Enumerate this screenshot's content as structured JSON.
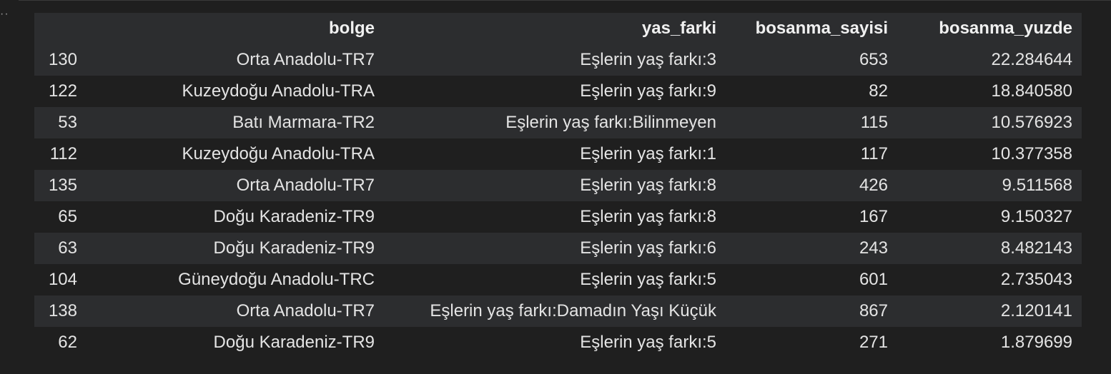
{
  "output": {
    "prompt_marker": "··"
  },
  "dataframe": {
    "index_header": "",
    "columns": [
      "bolge",
      "yas_farki",
      "bosanma_sayisi",
      "bosanma_yuzde"
    ],
    "rows": [
      {
        "index": "130",
        "bolge": "Orta Anadolu-TR7",
        "yas_farki": "Eşlerin yaş farkı:3",
        "bosanma_sayisi": "653",
        "bosanma_yuzde": "22.284644"
      },
      {
        "index": "122",
        "bolge": "Kuzeydoğu Anadolu-TRA",
        "yas_farki": "Eşlerin yaş farkı:9",
        "bosanma_sayisi": "82",
        "bosanma_yuzde": "18.840580"
      },
      {
        "index": "53",
        "bolge": "Batı Marmara-TR2",
        "yas_farki": "Eşlerin yaş farkı:Bilinmeyen",
        "bosanma_sayisi": "115",
        "bosanma_yuzde": "10.576923"
      },
      {
        "index": "112",
        "bolge": "Kuzeydoğu Anadolu-TRA",
        "yas_farki": "Eşlerin yaş farkı:1",
        "bosanma_sayisi": "117",
        "bosanma_yuzde": "10.377358"
      },
      {
        "index": "135",
        "bolge": "Orta Anadolu-TR7",
        "yas_farki": "Eşlerin yaş farkı:8",
        "bosanma_sayisi": "426",
        "bosanma_yuzde": "9.511568"
      },
      {
        "index": "65",
        "bolge": "Doğu Karadeniz-TR9",
        "yas_farki": "Eşlerin yaş farkı:8",
        "bosanma_sayisi": "167",
        "bosanma_yuzde": "9.150327"
      },
      {
        "index": "63",
        "bolge": "Doğu Karadeniz-TR9",
        "yas_farki": "Eşlerin yaş farkı:6",
        "bosanma_sayisi": "243",
        "bosanma_yuzde": "8.482143"
      },
      {
        "index": "104",
        "bolge": "Güneydoğu Anadolu-TRC",
        "yas_farki": "Eşlerin yaş farkı:5",
        "bosanma_sayisi": "601",
        "bosanma_yuzde": "2.735043"
      },
      {
        "index": "138",
        "bolge": "Orta Anadolu-TR7",
        "yas_farki": "Eşlerin yaş farkı:Damadın Yaşı Küçük",
        "bosanma_sayisi": "867",
        "bosanma_yuzde": "2.120141"
      },
      {
        "index": "62",
        "bolge": "Doğu Karadeniz-TR9",
        "yas_farki": "Eşlerin yaş farkı:5",
        "bosanma_sayisi": "271",
        "bosanma_yuzde": "1.879699"
      }
    ]
  }
}
